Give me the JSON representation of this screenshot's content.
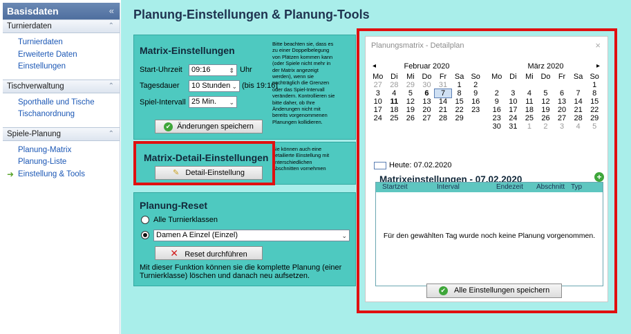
{
  "sidebar": {
    "title": "Basisdaten",
    "collapse_glyph": "«",
    "sections": [
      {
        "title": "Turnierdaten",
        "items": [
          "Turnierdaten",
          "Erweiterte Daten",
          "Einstellungen"
        ]
      },
      {
        "title": "Tischverwaltung",
        "items": [
          "Sporthalle und Tische",
          "Tischanordnung"
        ]
      },
      {
        "title": "Spiele-Planung",
        "items": [
          "Planung-Matrix",
          "Planung-Liste",
          "Einstellung & Tools"
        ]
      }
    ]
  },
  "page_title": "Planung-Einstellungen & Planung-Tools",
  "matrix": {
    "title": "Matrix-Einstellungen",
    "start_label": "Start-Uhrzeit",
    "start_value": "09:16",
    "start_unit": "Uhr",
    "day_label": "Tagesdauer",
    "day_value": "10 Stunden",
    "day_hint": "(bis 19:16)",
    "interval_label": "Spiel-Intervall",
    "interval_value": "25 Min.",
    "save_label": "Änderungen speichern",
    "note": "Bitte beachten sie, dass es\nzu einer Doppelbelegung\nvon Plätzen kommen kann\n(oder Spiele nicht mehr in\nder Matrix angezeigt\nwerden), wenn sie\nnachträglich die Grenzen\noder das Spiel-Intervall\nverändern. Kontrollieren sie\nbitte daher, ob Ihre\nÄnderungen nicht mit\nbereits vorgenommenen\nPlanungen kollidieren."
  },
  "detail": {
    "title": "Matrix-Detail-Einstellungen",
    "button_label": "Detail-Einstellung",
    "note": "Sie können auch eine\ndetailierte Einstellung mit\nunterschiedlichen\nAbschnitten vornehmen"
  },
  "reset": {
    "title": "Planung-Reset",
    "option_all": "Alle Turnierklassen",
    "option_select": "Damen A Einzel (Einzel)",
    "button_label": "Reset durchführen",
    "description": "Mit dieser Funktion können sie die komplette Planung (einer Turnierklasse) löschen und danach neu aufsetzen."
  },
  "dialog": {
    "title": "Planungsmatrix - Detailplan",
    "close_glyph": "×",
    "weekdays": [
      "Mo",
      "Di",
      "Mi",
      "Do",
      "Fr",
      "Sa",
      "So"
    ],
    "left_month": {
      "name": "Februar 2020",
      "weeks": [
        [
          "27",
          "28",
          "29",
          "30",
          "31",
          "1",
          "2"
        ],
        [
          "3",
          "4",
          "5",
          "6",
          "7",
          "8",
          "9"
        ],
        [
          "10",
          "11",
          "12",
          "13",
          "14",
          "15",
          "16"
        ],
        [
          "17",
          "18",
          "19",
          "20",
          "21",
          "22",
          "23"
        ],
        [
          "24",
          "25",
          "26",
          "27",
          "28",
          "29",
          ""
        ]
      ]
    },
    "right_month": {
      "name": "März 2020",
      "weeks": [
        [
          "",
          "",
          "",
          "",
          "",
          "",
          "1"
        ],
        [
          "2",
          "3",
          "4",
          "5",
          "6",
          "7",
          "8"
        ],
        [
          "9",
          "10",
          "11",
          "12",
          "13",
          "14",
          "15"
        ],
        [
          "16",
          "17",
          "18",
          "19",
          "20",
          "21",
          "22"
        ],
        [
          "23",
          "24",
          "25",
          "26",
          "27",
          "28",
          "29"
        ],
        [
          "30",
          "31",
          "1",
          "2",
          "3",
          "4",
          "5"
        ]
      ]
    },
    "today_label": "Heute: 07.02.2020",
    "matrix_title": "Matrixeinstellungen - 07.02.2020",
    "columns": [
      "Startzeit",
      "Interval",
      "Endezeit",
      "Abschnitt",
      "Typ"
    ],
    "empty_message": "Für den gewählten Tag wurde noch keine Planung vorgenommen.",
    "save_all_label": "Alle Einstellungen speichern"
  },
  "colors": {
    "accent": "#4ec9c0",
    "highlight": "#e01010",
    "link": "#1b57b5"
  }
}
